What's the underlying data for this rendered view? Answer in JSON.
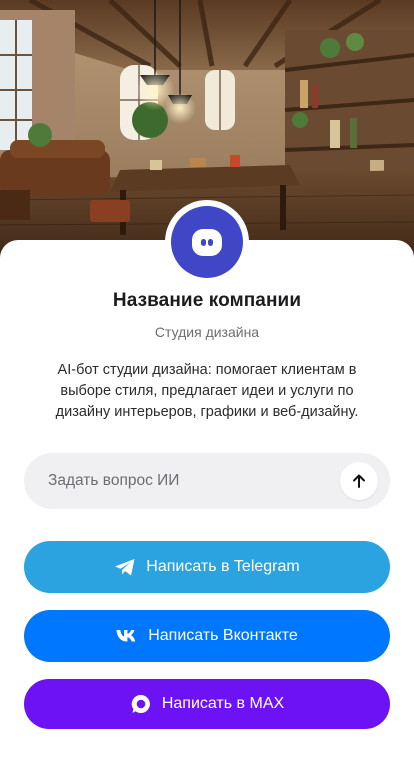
{
  "hero": {
    "description_icon": "loft-interior-image"
  },
  "profile": {
    "avatar_icon": "chat-bot-icon",
    "avatar_color": "#3f47c6",
    "name": "Название компании",
    "subtitle": "Студия дизайна",
    "description": "AI-бот студии дизайна: помогает клиентам в выборе стиля, предлагает идеи и услуги по дизайну интерьеров, графики и веб-дизайну."
  },
  "ask": {
    "placeholder": "Задать вопрос ИИ",
    "value": "",
    "send_icon": "arrow-up-icon"
  },
  "actions": [
    {
      "label": "Написать в Telegram",
      "icon": "telegram-icon",
      "color": "#2aa3e0"
    },
    {
      "label": "Написать Вконтакте",
      "icon": "vk-icon",
      "color": "#0077ff"
    },
    {
      "label": "Написать в MAX",
      "icon": "max-icon",
      "color": "#6c12f5"
    }
  ]
}
